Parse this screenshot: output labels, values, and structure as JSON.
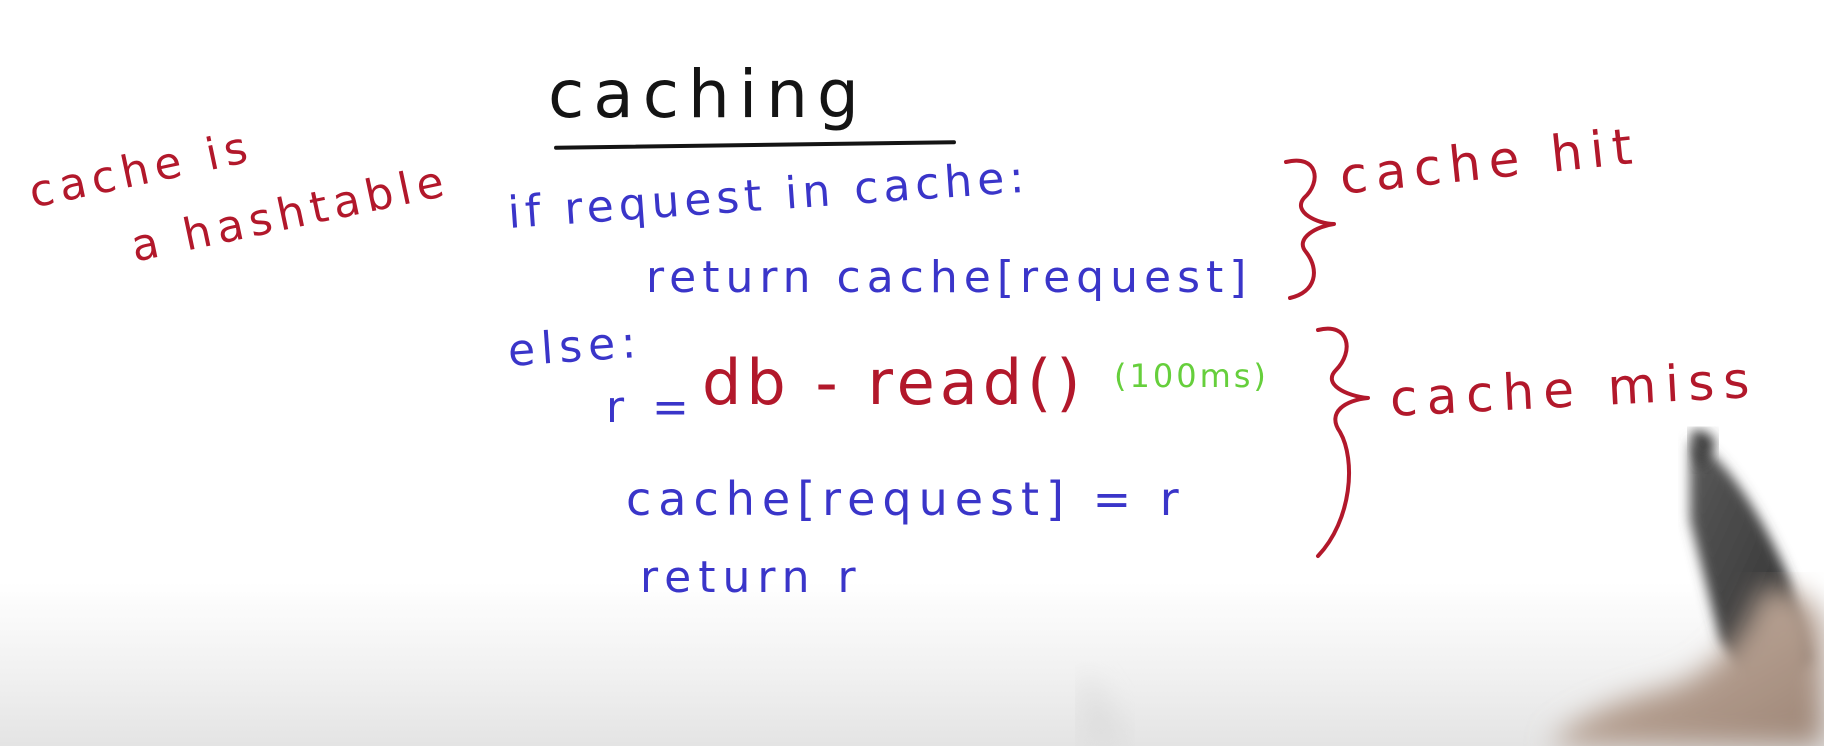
{
  "title": "caching",
  "side_note": {
    "line1": "cache is",
    "line2": "a hashtable"
  },
  "code": {
    "if_line": "if  request  in  cache:",
    "return_cached": "return  cache[request]",
    "else_line": "else:",
    "r_var": "r",
    "equals": "=",
    "db_read": "db - read()",
    "timing_note": "(100ms)",
    "assign_line": "cache[request] = r",
    "return_r": "return  r"
  },
  "labels": {
    "hit": "cache hit",
    "miss": "cache miss"
  },
  "colors": {
    "code_ink": "#3a35c9",
    "annotation_ink": "#b2182b",
    "title_ink": "#141414",
    "timing_ink": "#66cf3c",
    "board": "#ffffff"
  }
}
